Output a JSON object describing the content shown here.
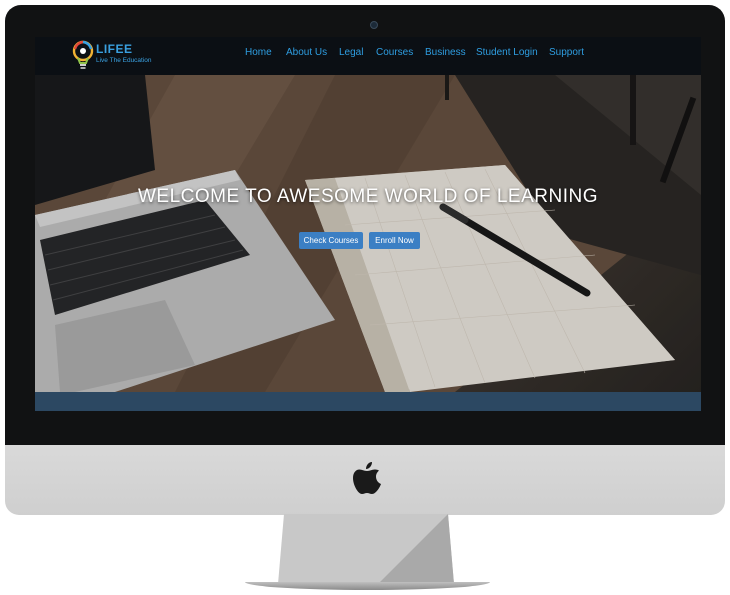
{
  "brand": {
    "name": "LIFEE",
    "tagline": "Live The Education"
  },
  "nav": {
    "items": [
      "Home",
      "About Us",
      "Legal",
      "Courses",
      "Business",
      "Student Login",
      "Support"
    ]
  },
  "hero": {
    "title": "WELCOME TO AWESOME WORLD OF LEARNING",
    "buttons": [
      "Check Courses",
      "Enroll Now"
    ]
  },
  "colors": {
    "accent": "#3b7fc4",
    "nav_link": "#2e9de0",
    "navbar_bg": "#0b0f14",
    "strip": "#2c4862"
  }
}
